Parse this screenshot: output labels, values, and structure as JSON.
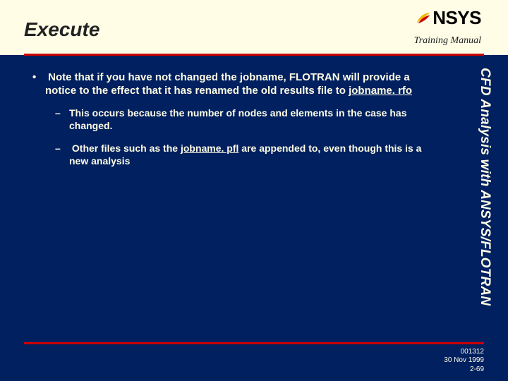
{
  "header": {
    "title": "Execute",
    "logo_text": "NSYS",
    "subtitle": "Training Manual"
  },
  "content": {
    "bullet1_pre": "Note that if you have not changed the jobname, FLOTRAN will provide a notice to the effect that it has renamed the old results file to ",
    "bullet1_u": "jobname. rfo",
    "sub1": "This occurs because the number of nodes and elements in the case has changed.",
    "sub2_pre": "Other files such as the ",
    "sub2_u": "jobname. pfl",
    "sub2_post": " are appended to, even though this is a new analysis"
  },
  "side_text": "CFD Analysis with ANSYS/FLOTRAN",
  "footer": {
    "code": "001312",
    "date": "30 Nov 1999",
    "page": "2-69"
  }
}
